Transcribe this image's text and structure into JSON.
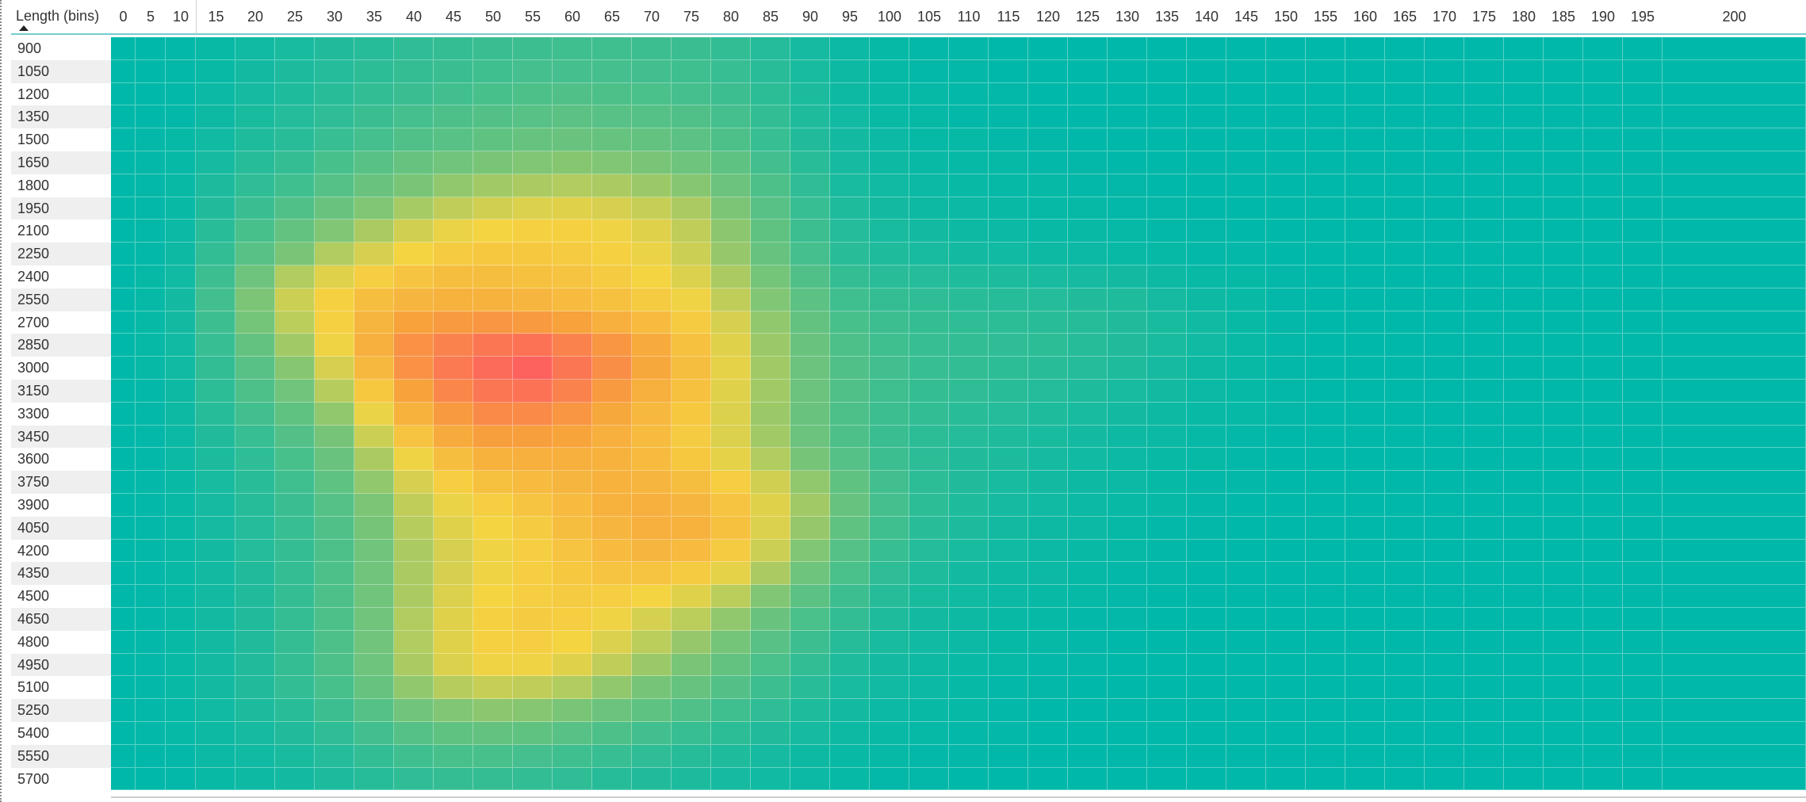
{
  "chart_data": {
    "type": "heatmap",
    "corner_label": "Length (bins)",
    "x_categories": [
      "0",
      "5",
      "10",
      "15",
      "20",
      "25",
      "30",
      "35",
      "40",
      "45",
      "50",
      "55",
      "60",
      "65",
      "70",
      "75",
      "80",
      "85",
      "90",
      "95",
      "100",
      "105",
      "110",
      "115",
      "120",
      "125",
      "130",
      "135",
      "140",
      "145",
      "150",
      "155",
      "160",
      "165",
      "170",
      "175",
      "180",
      "185",
      "190",
      "195",
      "200"
    ],
    "y_categories": [
      "900",
      "1050",
      "1200",
      "1350",
      "1500",
      "1650",
      "1800",
      "1950",
      "2100",
      "2250",
      "2400",
      "2550",
      "2700",
      "2850",
      "3000",
      "3150",
      "3300",
      "3450",
      "3600",
      "3750",
      "3900",
      "4050",
      "4200",
      "4350",
      "4500",
      "4650",
      "4800",
      "4950",
      "5100",
      "5250",
      "5400",
      "5550",
      "5700"
    ],
    "color_scale": {
      "low": "#00b8a9",
      "mid1": "#7cc576",
      "mid2": "#f5d442",
      "mid3": "#f7a23b",
      "high": "#fd625e"
    },
    "values": [
      [
        0,
        0,
        1,
        3,
        6,
        9,
        12,
        14,
        17,
        19,
        21,
        22,
        23,
        23,
        22,
        21,
        18,
        13,
        8,
        4,
        2,
        1,
        1,
        0,
        0,
        0,
        0,
        0,
        0,
        0,
        0,
        0,
        0,
        0,
        0,
        0,
        0,
        0,
        0,
        0,
        0
      ],
      [
        0,
        0,
        1,
        3,
        7,
        10,
        13,
        16,
        19,
        21,
        23,
        25,
        25,
        25,
        24,
        23,
        20,
        15,
        9,
        5,
        2,
        1,
        1,
        0,
        0,
        0,
        0,
        0,
        0,
        0,
        0,
        0,
        0,
        0,
        0,
        0,
        0,
        0,
        0,
        0,
        0
      ],
      [
        0,
        0,
        1,
        4,
        8,
        11,
        15,
        18,
        21,
        24,
        26,
        28,
        29,
        28,
        27,
        25,
        22,
        16,
        10,
        5,
        3,
        2,
        1,
        1,
        0,
        0,
        0,
        0,
        0,
        0,
        0,
        0,
        0,
        0,
        0,
        0,
        0,
        0,
        0,
        0,
        0
      ],
      [
        0,
        0,
        1,
        5,
        9,
        13,
        17,
        21,
        25,
        28,
        30,
        32,
        33,
        32,
        31,
        29,
        25,
        18,
        11,
        6,
        3,
        2,
        1,
        1,
        0,
        0,
        0,
        0,
        0,
        0,
        0,
        0,
        0,
        0,
        0,
        0,
        0,
        0,
        0,
        0,
        0
      ],
      [
        0,
        1,
        2,
        6,
        11,
        15,
        20,
        25,
        29,
        32,
        35,
        37,
        38,
        37,
        36,
        33,
        28,
        20,
        12,
        7,
        4,
        2,
        2,
        1,
        1,
        0,
        0,
        0,
        0,
        0,
        0,
        0,
        0,
        0,
        0,
        0,
        0,
        0,
        0,
        0,
        0
      ],
      [
        0,
        1,
        2,
        8,
        14,
        19,
        26,
        32,
        37,
        41,
        44,
        46,
        47,
        46,
        44,
        40,
        34,
        24,
        15,
        8,
        5,
        3,
        2,
        2,
        1,
        1,
        0,
        0,
        0,
        0,
        0,
        0,
        0,
        0,
        0,
        0,
        0,
        0,
        0,
        0,
        0
      ],
      [
        0,
        1,
        3,
        10,
        17,
        23,
        31,
        38,
        44,
        49,
        52,
        54,
        55,
        54,
        51,
        47,
        39,
        28,
        17,
        9,
        6,
        4,
        3,
        2,
        2,
        1,
        1,
        0,
        0,
        0,
        0,
        0,
        0,
        0,
        0,
        0,
        0,
        0,
        0,
        0,
        0
      ],
      [
        0,
        1,
        3,
        12,
        21,
        29,
        38,
        46,
        53,
        58,
        61,
        63,
        64,
        62,
        59,
        54,
        45,
        32,
        20,
        11,
        7,
        5,
        4,
        3,
        2,
        2,
        1,
        1,
        0,
        0,
        0,
        0,
        0,
        0,
        0,
        0,
        0,
        0,
        0,
        0,
        0
      ],
      [
        0,
        1,
        4,
        15,
        26,
        36,
        46,
        54,
        61,
        66,
        68,
        69,
        69,
        67,
        64,
        58,
        48,
        35,
        22,
        13,
        9,
        7,
        5,
        4,
        3,
        3,
        2,
        1,
        1,
        0,
        0,
        0,
        0,
        0,
        0,
        0,
        0,
        0,
        0,
        0,
        0
      ],
      [
        0,
        1,
        5,
        18,
        32,
        44,
        55,
        62,
        68,
        71,
        72,
        72,
        71,
        69,
        66,
        60,
        50,
        37,
        25,
        15,
        11,
        9,
        7,
        6,
        5,
        4,
        3,
        2,
        1,
        1,
        0,
        0,
        0,
        0,
        0,
        0,
        0,
        0,
        0,
        0,
        0
      ],
      [
        0,
        2,
        6,
        22,
        40,
        55,
        64,
        70,
        73,
        75,
        75,
        74,
        73,
        71,
        68,
        63,
        54,
        42,
        29,
        19,
        15,
        13,
        11,
        10,
        9,
        8,
        7,
        5,
        3,
        2,
        1,
        0,
        0,
        0,
        0,
        0,
        0,
        0,
        0,
        0,
        0
      ],
      [
        0,
        2,
        7,
        24,
        45,
        60,
        69,
        75,
        78,
        79,
        79,
        78,
        76,
        74,
        71,
        67,
        58,
        46,
        33,
        23,
        19,
        17,
        15,
        14,
        13,
        12,
        11,
        8,
        5,
        3,
        1,
        0,
        0,
        0,
        0,
        0,
        0,
        0,
        0,
        0,
        0
      ],
      [
        0,
        2,
        7,
        22,
        42,
        57,
        69,
        78,
        84,
        86,
        87,
        86,
        84,
        80,
        76,
        71,
        62,
        49,
        36,
        26,
        22,
        19,
        17,
        16,
        15,
        14,
        12,
        9,
        6,
        3,
        1,
        0,
        0,
        0,
        0,
        0,
        0,
        0,
        0,
        0,
        0
      ],
      [
        0,
        2,
        6,
        20,
        36,
        52,
        67,
        80,
        88,
        92,
        95,
        96,
        92,
        87,
        81,
        74,
        64,
        51,
        38,
        28,
        23,
        20,
        18,
        17,
        16,
        14,
        12,
        9,
        6,
        3,
        1,
        0,
        0,
        0,
        0,
        0,
        0,
        0,
        0,
        0,
        0
      ],
      [
        0,
        2,
        6,
        18,
        32,
        47,
        62,
        77,
        88,
        94,
        98,
        100,
        95,
        89,
        82,
        75,
        65,
        52,
        39,
        29,
        24,
        20,
        18,
        16,
        15,
        13,
        11,
        8,
        5,
        3,
        1,
        0,
        0,
        0,
        0,
        0,
        0,
        0,
        0,
        0,
        0
      ],
      [
        0,
        1,
        5,
        16,
        28,
        41,
        56,
        72,
        84,
        91,
        95,
        96,
        92,
        86,
        80,
        74,
        64,
        52,
        39,
        29,
        23,
        19,
        17,
        15,
        13,
        11,
        9,
        7,
        4,
        2,
        1,
        0,
        0,
        0,
        0,
        0,
        0,
        0,
        0,
        0,
        0
      ],
      [
        0,
        1,
        5,
        14,
        24,
        35,
        49,
        66,
        79,
        86,
        90,
        90,
        87,
        82,
        77,
        72,
        63,
        51,
        38,
        28,
        22,
        18,
        15,
        13,
        11,
        9,
        7,
        5,
        3,
        2,
        1,
        0,
        0,
        0,
        0,
        0,
        0,
        0,
        0,
        0,
        0
      ],
      [
        0,
        1,
        4,
        12,
        20,
        30,
        43,
        60,
        73,
        81,
        85,
        85,
        83,
        80,
        76,
        71,
        63,
        52,
        39,
        28,
        21,
        16,
        13,
        11,
        9,
        7,
        5,
        4,
        2,
        1,
        0,
        0,
        0,
        0,
        0,
        0,
        0,
        0,
        0,
        0,
        0
      ],
      [
        0,
        1,
        4,
        10,
        17,
        26,
        38,
        54,
        67,
        75,
        79,
        80,
        80,
        79,
        76,
        72,
        65,
        55,
        43,
        31,
        22,
        16,
        12,
        10,
        8,
        6,
        4,
        3,
        2,
        1,
        0,
        0,
        0,
        0,
        0,
        0,
        0,
        0,
        0,
        0,
        0
      ],
      [
        0,
        1,
        3,
        9,
        15,
        23,
        34,
        49,
        62,
        70,
        74,
        76,
        78,
        79,
        78,
        75,
        70,
        61,
        49,
        35,
        24,
        16,
        12,
        9,
        7,
        5,
        4,
        2,
        1,
        1,
        0,
        0,
        0,
        0,
        0,
        0,
        0,
        0,
        0,
        0,
        0
      ],
      [
        0,
        1,
        3,
        8,
        14,
        21,
        31,
        45,
        58,
        66,
        70,
        73,
        76,
        79,
        80,
        78,
        73,
        64,
        52,
        37,
        25,
        16,
        11,
        8,
        6,
        4,
        3,
        2,
        1,
        0,
        0,
        0,
        0,
        0,
        0,
        0,
        0,
        0,
        0,
        0,
        0
      ],
      [
        0,
        1,
        3,
        8,
        13,
        20,
        29,
        43,
        56,
        64,
        68,
        71,
        75,
        78,
        80,
        79,
        74,
        63,
        50,
        35,
        23,
        15,
        10,
        7,
        5,
        4,
        2,
        1,
        1,
        0,
        0,
        0,
        0,
        0,
        0,
        0,
        0,
        0,
        0,
        0,
        0
      ],
      [
        0,
        1,
        3,
        7,
        13,
        19,
        28,
        41,
        54,
        62,
        67,
        70,
        73,
        76,
        78,
        76,
        71,
        60,
        46,
        31,
        20,
        13,
        9,
        6,
        4,
        3,
        2,
        1,
        0,
        0,
        0,
        0,
        0,
        0,
        0,
        0,
        0,
        0,
        0,
        0,
        0
      ],
      [
        0,
        1,
        3,
        7,
        12,
        19,
        28,
        41,
        54,
        62,
        67,
        70,
        72,
        73,
        73,
        71,
        65,
        54,
        40,
        27,
        17,
        11,
        7,
        5,
        4,
        2,
        1,
        1,
        0,
        0,
        0,
        0,
        0,
        0,
        0,
        0,
        0,
        0,
        0,
        0,
        0
      ],
      [
        0,
        1,
        3,
        7,
        12,
        19,
        28,
        41,
        54,
        63,
        68,
        70,
        71,
        70,
        68,
        64,
        57,
        46,
        33,
        22,
        14,
        9,
        6,
        4,
        3,
        2,
        1,
        0,
        0,
        0,
        0,
        0,
        0,
        0,
        0,
        0,
        0,
        0,
        0,
        0,
        0
      ],
      [
        0,
        1,
        3,
        7,
        12,
        19,
        28,
        41,
        55,
        64,
        69,
        71,
        70,
        67,
        62,
        57,
        49,
        38,
        27,
        18,
        11,
        7,
        5,
        3,
        2,
        1,
        1,
        0,
        0,
        0,
        0,
        0,
        0,
        0,
        0,
        0,
        0,
        0,
        0,
        0,
        0
      ],
      [
        0,
        1,
        3,
        7,
        12,
        19,
        28,
        41,
        55,
        64,
        69,
        70,
        68,
        63,
        57,
        50,
        42,
        32,
        22,
        14,
        9,
        6,
        4,
        2,
        2,
        1,
        0,
        0,
        0,
        0,
        0,
        0,
        0,
        0,
        0,
        0,
        0,
        0,
        0,
        0,
        0
      ],
      [
        0,
        1,
        3,
        7,
        12,
        19,
        28,
        40,
        54,
        63,
        67,
        67,
        64,
        58,
        51,
        44,
        36,
        27,
        18,
        11,
        7,
        5,
        3,
        2,
        1,
        1,
        0,
        0,
        0,
        0,
        0,
        0,
        0,
        0,
        0,
        0,
        0,
        0,
        0,
        0,
        0
      ],
      [
        0,
        1,
        3,
        7,
        12,
        18,
        26,
        37,
        49,
        56,
        59,
        58,
        55,
        49,
        43,
        37,
        30,
        22,
        15,
        9,
        6,
        4,
        2,
        1,
        1,
        0,
        0,
        0,
        0,
        0,
        0,
        0,
        0,
        0,
        0,
        0,
        0,
        0,
        0,
        0,
        0
      ],
      [
        0,
        1,
        2,
        6,
        10,
        15,
        22,
        31,
        41,
        46,
        48,
        47,
        44,
        39,
        34,
        29,
        23,
        17,
        11,
        7,
        4,
        3,
        2,
        1,
        0,
        0,
        0,
        0,
        0,
        0,
        0,
        0,
        0,
        0,
        0,
        0,
        0,
        0,
        0,
        0,
        0
      ],
      [
        0,
        1,
        2,
        5,
        8,
        12,
        17,
        24,
        31,
        35,
        36,
        35,
        32,
        28,
        24,
        20,
        16,
        12,
        8,
        5,
        3,
        2,
        1,
        1,
        0,
        0,
        0,
        0,
        0,
        0,
        0,
        0,
        0,
        0,
        0,
        0,
        0,
        0,
        0,
        0,
        0
      ],
      [
        0,
        0,
        1,
        4,
        6,
        9,
        13,
        18,
        23,
        26,
        26,
        25,
        23,
        20,
        17,
        14,
        11,
        8,
        5,
        3,
        2,
        1,
        1,
        0,
        0,
        0,
        0,
        0,
        0,
        0,
        0,
        0,
        0,
        0,
        0,
        0,
        0,
        0,
        0,
        0,
        0
      ],
      [
        0,
        0,
        1,
        3,
        5,
        7,
        10,
        14,
        17,
        19,
        19,
        18,
        17,
        14,
        12,
        10,
        8,
        6,
        4,
        2,
        1,
        1,
        0,
        0,
        0,
        0,
        0,
        0,
        0,
        0,
        0,
        0,
        0,
        0,
        0,
        0,
        0,
        0,
        0,
        0,
        0
      ]
    ],
    "value_range": [
      0,
      100
    ],
    "grid": true,
    "legend": "none"
  }
}
